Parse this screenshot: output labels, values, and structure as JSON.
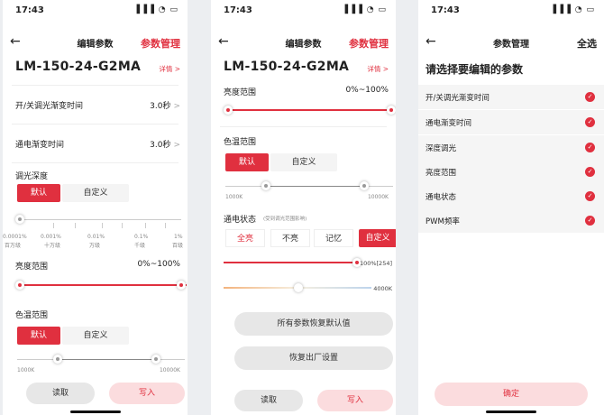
{
  "status": {
    "time": "17:43",
    "icons": "▐▐▐ ◔ ▭"
  },
  "screen1": {
    "nav": {
      "back": "←",
      "title": "编辑参数",
      "right": "参数管理"
    },
    "model": "LM-150-24-G2MA",
    "detail": "详情 >",
    "fade": {
      "label": "开/关调光渐变时间",
      "value": "3.0秒"
    },
    "power_fade": {
      "label": "通电渐变时间",
      "value": "3.0秒"
    },
    "dim_depth": {
      "label": "调光深度",
      "options": [
        "默认",
        "自定义"
      ],
      "scale_top": [
        "0.0001%",
        "0.001%",
        "0.01%",
        "0.1%",
        "1%"
      ],
      "scale_bottom": [
        "百万级",
        "十万级",
        "万级",
        "千级",
        "百级"
      ]
    },
    "brightness": {
      "label": "亮度范围",
      "value": "0%~100%"
    },
    "cct": {
      "label": "色温范围",
      "options": [
        "默认",
        "自定义"
      ],
      "min": "1000K",
      "max": "10000K"
    },
    "buttons": {
      "read": "读取",
      "write": "写入"
    }
  },
  "screen2": {
    "nav": {
      "back": "←",
      "title": "编辑参数",
      "right": "参数管理"
    },
    "model": "LM-150-24-G2MA",
    "detail": "详情 >",
    "brightness": {
      "label": "亮度范围",
      "value": "0%~100%"
    },
    "cct": {
      "label": "色温范围",
      "options": [
        "默认",
        "自定义"
      ],
      "min": "1000K",
      "max": "10000K"
    },
    "power_state": {
      "label": "通电状态",
      "hint": "(受到调光范围影响)",
      "options": [
        "全亮",
        "不亮",
        "记忆",
        "自定义"
      ],
      "level": "100%[254]",
      "temp": "4000K"
    },
    "restore_defaults": "所有参数恢复默认值",
    "factory_reset": "恢复出厂设置",
    "buttons": {
      "read": "读取",
      "write": "写入"
    }
  },
  "screen3": {
    "nav": {
      "back": "←",
      "title": "参数管理",
      "right": "全选"
    },
    "heading": "请选择要编辑的参数",
    "items": [
      "开/关调光渐变时间",
      "通电渐变时间",
      "深度调光",
      "亮度范围",
      "通电状态",
      "PWM频率"
    ],
    "confirm": "确定"
  },
  "colors": {
    "accent": "#e0303f",
    "pink": "#fbdcde",
    "gray_button": "#e7e7e7"
  }
}
